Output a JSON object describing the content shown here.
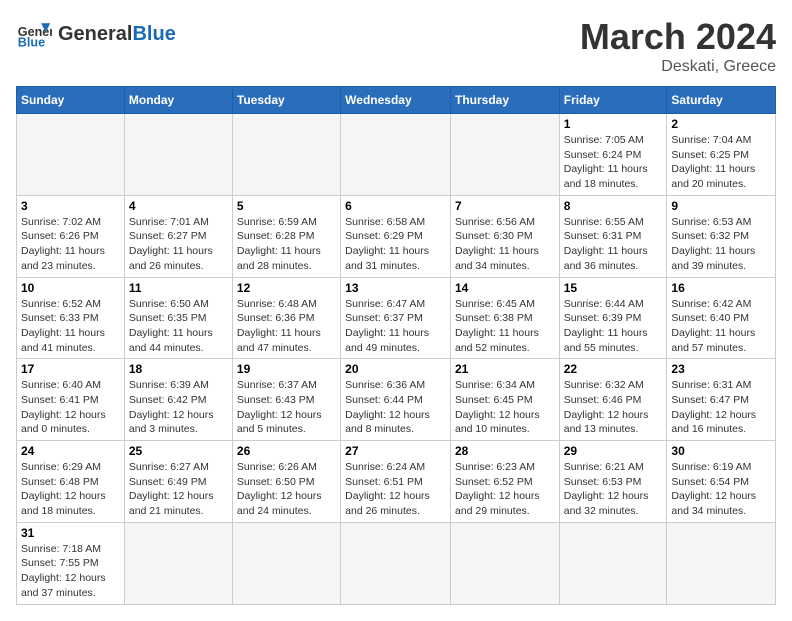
{
  "header": {
    "logo_general": "General",
    "logo_blue": "Blue",
    "month_title": "March 2024",
    "subtitle": "Deskati, Greece"
  },
  "weekdays": [
    "Sunday",
    "Monday",
    "Tuesday",
    "Wednesday",
    "Thursday",
    "Friday",
    "Saturday"
  ],
  "weeks": [
    [
      {
        "day": "",
        "info": ""
      },
      {
        "day": "",
        "info": ""
      },
      {
        "day": "",
        "info": ""
      },
      {
        "day": "",
        "info": ""
      },
      {
        "day": "",
        "info": ""
      },
      {
        "day": "1",
        "info": "Sunrise: 7:05 AM\nSunset: 6:24 PM\nDaylight: 11 hours and 18 minutes."
      },
      {
        "day": "2",
        "info": "Sunrise: 7:04 AM\nSunset: 6:25 PM\nDaylight: 11 hours and 20 minutes."
      }
    ],
    [
      {
        "day": "3",
        "info": "Sunrise: 7:02 AM\nSunset: 6:26 PM\nDaylight: 11 hours and 23 minutes."
      },
      {
        "day": "4",
        "info": "Sunrise: 7:01 AM\nSunset: 6:27 PM\nDaylight: 11 hours and 26 minutes."
      },
      {
        "day": "5",
        "info": "Sunrise: 6:59 AM\nSunset: 6:28 PM\nDaylight: 11 hours and 28 minutes."
      },
      {
        "day": "6",
        "info": "Sunrise: 6:58 AM\nSunset: 6:29 PM\nDaylight: 11 hours and 31 minutes."
      },
      {
        "day": "7",
        "info": "Sunrise: 6:56 AM\nSunset: 6:30 PM\nDaylight: 11 hours and 34 minutes."
      },
      {
        "day": "8",
        "info": "Sunrise: 6:55 AM\nSunset: 6:31 PM\nDaylight: 11 hours and 36 minutes."
      },
      {
        "day": "9",
        "info": "Sunrise: 6:53 AM\nSunset: 6:32 PM\nDaylight: 11 hours and 39 minutes."
      }
    ],
    [
      {
        "day": "10",
        "info": "Sunrise: 6:52 AM\nSunset: 6:33 PM\nDaylight: 11 hours and 41 minutes."
      },
      {
        "day": "11",
        "info": "Sunrise: 6:50 AM\nSunset: 6:35 PM\nDaylight: 11 hours and 44 minutes."
      },
      {
        "day": "12",
        "info": "Sunrise: 6:48 AM\nSunset: 6:36 PM\nDaylight: 11 hours and 47 minutes."
      },
      {
        "day": "13",
        "info": "Sunrise: 6:47 AM\nSunset: 6:37 PM\nDaylight: 11 hours and 49 minutes."
      },
      {
        "day": "14",
        "info": "Sunrise: 6:45 AM\nSunset: 6:38 PM\nDaylight: 11 hours and 52 minutes."
      },
      {
        "day": "15",
        "info": "Sunrise: 6:44 AM\nSunset: 6:39 PM\nDaylight: 11 hours and 55 minutes."
      },
      {
        "day": "16",
        "info": "Sunrise: 6:42 AM\nSunset: 6:40 PM\nDaylight: 11 hours and 57 minutes."
      }
    ],
    [
      {
        "day": "17",
        "info": "Sunrise: 6:40 AM\nSunset: 6:41 PM\nDaylight: 12 hours and 0 minutes."
      },
      {
        "day": "18",
        "info": "Sunrise: 6:39 AM\nSunset: 6:42 PM\nDaylight: 12 hours and 3 minutes."
      },
      {
        "day": "19",
        "info": "Sunrise: 6:37 AM\nSunset: 6:43 PM\nDaylight: 12 hours and 5 minutes."
      },
      {
        "day": "20",
        "info": "Sunrise: 6:36 AM\nSunset: 6:44 PM\nDaylight: 12 hours and 8 minutes."
      },
      {
        "day": "21",
        "info": "Sunrise: 6:34 AM\nSunset: 6:45 PM\nDaylight: 12 hours and 10 minutes."
      },
      {
        "day": "22",
        "info": "Sunrise: 6:32 AM\nSunset: 6:46 PM\nDaylight: 12 hours and 13 minutes."
      },
      {
        "day": "23",
        "info": "Sunrise: 6:31 AM\nSunset: 6:47 PM\nDaylight: 12 hours and 16 minutes."
      }
    ],
    [
      {
        "day": "24",
        "info": "Sunrise: 6:29 AM\nSunset: 6:48 PM\nDaylight: 12 hours and 18 minutes."
      },
      {
        "day": "25",
        "info": "Sunrise: 6:27 AM\nSunset: 6:49 PM\nDaylight: 12 hours and 21 minutes."
      },
      {
        "day": "26",
        "info": "Sunrise: 6:26 AM\nSunset: 6:50 PM\nDaylight: 12 hours and 24 minutes."
      },
      {
        "day": "27",
        "info": "Sunrise: 6:24 AM\nSunset: 6:51 PM\nDaylight: 12 hours and 26 minutes."
      },
      {
        "day": "28",
        "info": "Sunrise: 6:23 AM\nSunset: 6:52 PM\nDaylight: 12 hours and 29 minutes."
      },
      {
        "day": "29",
        "info": "Sunrise: 6:21 AM\nSunset: 6:53 PM\nDaylight: 12 hours and 32 minutes."
      },
      {
        "day": "30",
        "info": "Sunrise: 6:19 AM\nSunset: 6:54 PM\nDaylight: 12 hours and 34 minutes."
      }
    ],
    [
      {
        "day": "31",
        "info": "Sunrise: 7:18 AM\nSunset: 7:55 PM\nDaylight: 12 hours and 37 minutes."
      },
      {
        "day": "",
        "info": ""
      },
      {
        "day": "",
        "info": ""
      },
      {
        "day": "",
        "info": ""
      },
      {
        "day": "",
        "info": ""
      },
      {
        "day": "",
        "info": ""
      },
      {
        "day": "",
        "info": ""
      }
    ]
  ]
}
